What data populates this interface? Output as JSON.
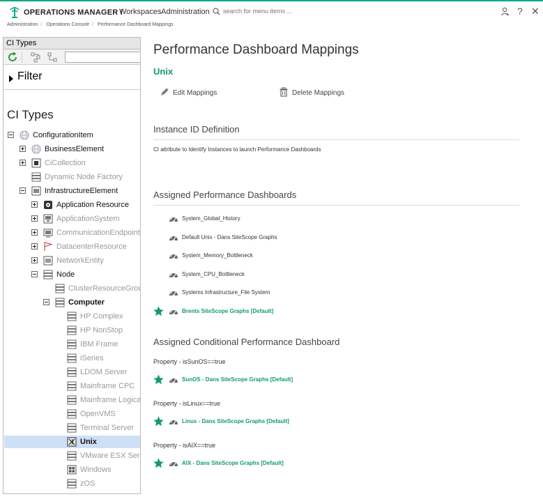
{
  "header": {
    "brand": "OPERATIONS MANAGER i",
    "nav": [
      "Workspaces",
      "Administration"
    ],
    "search_placeholder": "search for menu items ..."
  },
  "breadcrumb": [
    "Administration",
    "Operations Console",
    "Performance Dashboard Mappings"
  ],
  "left_panel": {
    "title": "CI Types",
    "filter_label": "Filter",
    "heading": "CI Types",
    "tree": [
      {
        "label": "ConfigurationItem",
        "indent": 0,
        "expander": "minus",
        "style": "dark",
        "icon": "ci-root-icon"
      },
      {
        "label": "BusinessElement",
        "indent": 1,
        "expander": "plus",
        "style": "dark",
        "icon": "business-icon"
      },
      {
        "label": "CiCollection",
        "indent": 1,
        "expander": "plus",
        "style": "dim",
        "icon": "collection-icon"
      },
      {
        "label": "Dynamic Node Factory",
        "indent": 1,
        "expander": "none",
        "style": "dim",
        "icon": "server-icon"
      },
      {
        "label": "InfrastructureElement",
        "indent": 1,
        "expander": "minus",
        "style": "dark",
        "icon": "infrastructure-icon"
      },
      {
        "label": "Application Resource",
        "indent": 2,
        "expander": "plus",
        "style": "dark",
        "icon": "app-resource-icon"
      },
      {
        "label": "ApplicationSystem",
        "indent": 2,
        "expander": "plus",
        "style": "dim",
        "icon": "app-system-icon"
      },
      {
        "label": "CommunicationEndpoint",
        "indent": 2,
        "expander": "plus",
        "style": "dim",
        "icon": "endpoint-icon"
      },
      {
        "label": "DatacenterResource",
        "indent": 2,
        "expander": "plus",
        "style": "dim",
        "icon": "flag-icon"
      },
      {
        "label": "NetworkEntity",
        "indent": 2,
        "expander": "plus",
        "style": "dim",
        "icon": "network-icon"
      },
      {
        "label": "Node",
        "indent": 2,
        "expander": "minus",
        "style": "dark",
        "icon": "server-icon"
      },
      {
        "label": "ClusterResourceGrou",
        "indent": 3,
        "expander": "none",
        "style": "dim",
        "icon": "server-icon"
      },
      {
        "label": "Computer",
        "indent": 3,
        "expander": "minus",
        "style": "bold",
        "icon": "server-icon"
      },
      {
        "label": "HP Complex",
        "indent": 4,
        "expander": "none",
        "style": "dim",
        "icon": "server-icon"
      },
      {
        "label": "HP NonStop",
        "indent": 4,
        "expander": "none",
        "style": "dim",
        "icon": "server-icon"
      },
      {
        "label": "IBM Frame",
        "indent": 4,
        "expander": "none",
        "style": "dim",
        "icon": "server-icon"
      },
      {
        "label": "iSeries",
        "indent": 4,
        "expander": "none",
        "style": "dim",
        "icon": "server-icon"
      },
      {
        "label": "LDOM Server",
        "indent": 4,
        "expander": "none",
        "style": "dim",
        "icon": "server-icon"
      },
      {
        "label": "Mainframe CPC",
        "indent": 4,
        "expander": "none",
        "style": "dim",
        "icon": "server-icon"
      },
      {
        "label": "Mainframe Logica",
        "indent": 4,
        "expander": "none",
        "style": "dim",
        "icon": "server-icon"
      },
      {
        "label": "OpenVMS",
        "indent": 4,
        "expander": "none",
        "style": "dim",
        "icon": "server-icon"
      },
      {
        "label": "Terminal Server",
        "indent": 4,
        "expander": "none",
        "style": "dim",
        "icon": "server-icon"
      },
      {
        "label": "Unix",
        "indent": 4,
        "expander": "none",
        "style": "bold",
        "icon": "unix-icon"
      },
      {
        "label": "VMware ESX Ser",
        "indent": 4,
        "expander": "none",
        "style": "dim",
        "icon": "server-icon"
      },
      {
        "label": "Windows",
        "indent": 4,
        "expander": "none",
        "style": "dim",
        "icon": "windows-icon"
      },
      {
        "label": "zOS",
        "indent": 4,
        "expander": "none",
        "style": "dim",
        "icon": "server-icon"
      }
    ]
  },
  "main": {
    "title": "Performance Dashboard Mappings",
    "subtitle": "Unix",
    "edit_label": "Edit Mappings",
    "delete_label": "Delete Mappings",
    "instance_title": "Instance ID Definition",
    "instance_desc": "CI attribute to Identify Instances to launch Performance Dashboards",
    "assigned_title": "Assigned Performance Dashboards",
    "assigned": [
      {
        "label": "System_Global_History",
        "default": false
      },
      {
        "label": "Default Unix - Dans SiteScope Graphs",
        "default": false
      },
      {
        "label": "System_Memory_Bottleneck",
        "default": false
      },
      {
        "label": "System_CPU_Bottleneck",
        "default": false
      },
      {
        "label": "Systems Infrastructure_File System",
        "default": false
      },
      {
        "label": "Brents SiteScope Graphs [Default]",
        "default": true
      }
    ],
    "conditional_title": "Assigned Conditional Performance Dashboard",
    "conditional": [
      {
        "property": "Property - isSunOS==true",
        "dashboard": "SunOS - Dans SiteScope Graphs [Default]"
      },
      {
        "property": "Property - isLinux==true",
        "dashboard": "Linux - Dans SiteScope Graphs [Default]"
      },
      {
        "property": "Property - isAIX==true",
        "dashboard": "AIX - Dans SiteScope Graphs [Default]"
      }
    ]
  },
  "colors": {
    "accent": "#129b6e",
    "selection": "#cde0f5"
  }
}
